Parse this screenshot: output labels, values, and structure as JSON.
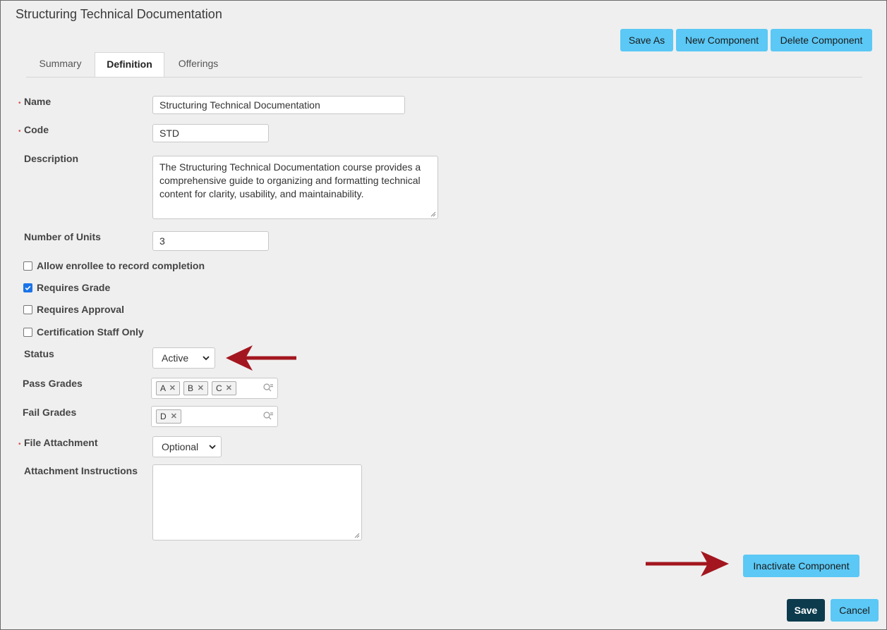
{
  "page": {
    "title": "Structuring Technical Documentation"
  },
  "toolbar": {
    "save_as": "Save As",
    "new_component": "New Component",
    "delete_component": "Delete Component"
  },
  "tabs": [
    {
      "label": "Summary",
      "active": false
    },
    {
      "label": "Definition",
      "active": true
    },
    {
      "label": "Offerings",
      "active": false
    }
  ],
  "form": {
    "name": {
      "label": "Name",
      "value": "Structuring Technical Documentation",
      "required": true
    },
    "code": {
      "label": "Code",
      "value": "STD",
      "required": true
    },
    "description": {
      "label": "Description",
      "value": "The Structuring Technical Documentation course provides a comprehensive guide to organizing and formatting technical content for clarity, usability, and maintainability."
    },
    "units": {
      "label": "Number of Units",
      "value": "3"
    },
    "checks": [
      {
        "label": "Allow enrollee to record completion",
        "checked": false
      },
      {
        "label": "Requires Grade",
        "checked": true
      },
      {
        "label": "Requires Approval",
        "checked": false
      },
      {
        "label": "Certification Staff Only",
        "checked": false
      }
    ],
    "status": {
      "label": "Status",
      "value": "Active"
    },
    "pass_grades": {
      "label": "Pass Grades",
      "tags": [
        "A",
        "B",
        "C"
      ]
    },
    "fail_grades": {
      "label": "Fail Grades",
      "tags": [
        "D"
      ]
    },
    "file_attachment": {
      "label": "File Attachment",
      "value": "Optional",
      "required": true
    },
    "attachment_instructions": {
      "label": "Attachment Instructions",
      "value": ""
    }
  },
  "actions": {
    "inactivate": "Inactivate Component",
    "save": "Save",
    "cancel": "Cancel"
  },
  "colors": {
    "accent": "#5bc8f5",
    "primary_dark": "#0c3b4d",
    "arrow": "#a3161f",
    "required": "#d9534f"
  }
}
